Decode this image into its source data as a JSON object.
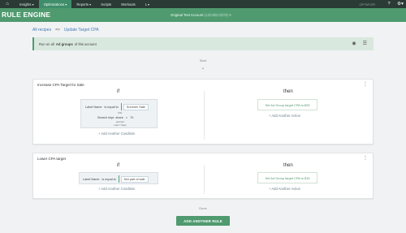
{
  "nav": {
    "items": [
      {
        "label": "Insights ▾",
        "active": false
      },
      {
        "label": "Optimizations ▾",
        "active": true
      },
      {
        "label": "Reports ▾",
        "active": false
      },
      {
        "label": "Scripts",
        "active": false
      },
      {
        "label": "Workouts",
        "active": false
      },
      {
        "label": "L ▾",
        "active": false
      }
    ],
    "right_label": "OPTMYZR",
    "help_icon": "help-icon",
    "settings_icon": "gear-icon"
  },
  "header": {
    "title": "RULE ENGINE",
    "account_label": "Original Test Account",
    "account_id": "(140-860-5078) ▾"
  },
  "breadcrumb": {
    "root": "All recipes",
    "separator": "=>",
    "current": "Update Target CPA"
  },
  "infobar": {
    "prefix": "Run on all",
    "bold": "Ad groups",
    "suffix": "of this account"
  },
  "flow": {
    "start": "Start",
    "plus": "+",
    "done": "Done"
  },
  "rules": [
    {
      "name": "Increase CPA Target for Sale",
      "if_label": "if",
      "then_label": "then",
      "conditions": [
        {
          "label": "Label Name",
          "op": "is equal to",
          "value": "Summer Sale"
        },
        {
          "label": "Search impr. share",
          "op": ">",
          "value": "70"
        }
      ],
      "and_label": "and",
      "unit_label": "percent",
      "range_label": "Last 7 days",
      "add_condition": "+ Add Another Condition",
      "action": "Set Ad Group target CPA to $25",
      "add_action": "+ Add Another Action"
    },
    {
      "name": "Lower CPA target",
      "if_label": "if",
      "then_label": "then",
      "conditions": [
        {
          "label": "Label Name",
          "op": "is equal to",
          "value": "Not part of sale"
        }
      ],
      "add_condition": "+ Add Another Condition",
      "action": "Set Ad Group target CPA to $15",
      "add_action": "+ Add Another Action"
    }
  ],
  "add_rule_button": "ADD ANOTHER RULE",
  "colors": {
    "brand_green": "#4f9a6f",
    "nav_bg": "#2a3a35",
    "link_blue": "#3d7bb8"
  }
}
